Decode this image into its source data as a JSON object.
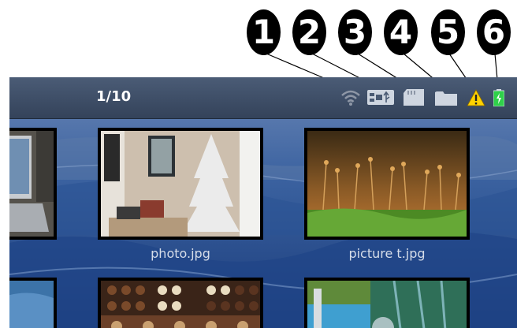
{
  "callouts": [
    "1",
    "2",
    "3",
    "4",
    "5",
    "6"
  ],
  "header": {
    "counter": "1/10"
  },
  "status_icons": [
    "wifi-icon",
    "usb-icon",
    "memory-card-icon",
    "folder-icon",
    "warning-icon",
    "battery-icon"
  ],
  "gallery": {
    "items": [
      {
        "name": "photo.jpg"
      },
      {
        "name": "picture t.jpg"
      }
    ]
  },
  "colors": {
    "topbar": "#3f4f68",
    "background_blue": "#2e4f85",
    "warning": "#ffd200",
    "battery": "#2fd14a",
    "callout": "#000000"
  }
}
